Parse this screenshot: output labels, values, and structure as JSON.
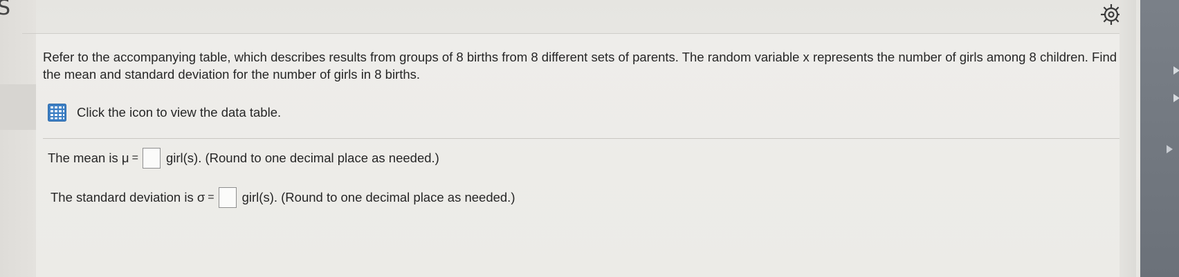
{
  "question": {
    "text": "Refer to the accompanying table, which describes results from groups of 8 births from 8 different sets of parents. The random variable x represents the number of girls among 8 children. Find the mean and standard deviation for the number of girls in 8 births."
  },
  "data_table_hint": {
    "icon": "table-icon",
    "label": "Click the icon to view the data table."
  },
  "answers": [
    {
      "prefix": "The mean is μ",
      "equals": "=",
      "value": "",
      "suffix": "girl(s). (Round to one decimal place as needed.)"
    },
    {
      "prefix": "The standard deviation is σ",
      "equals": "=",
      "value": "",
      "suffix": "girl(s). (Round to one decimal place as needed.)"
    }
  ],
  "toolbar": {
    "settings_icon": "gear-icon"
  }
}
